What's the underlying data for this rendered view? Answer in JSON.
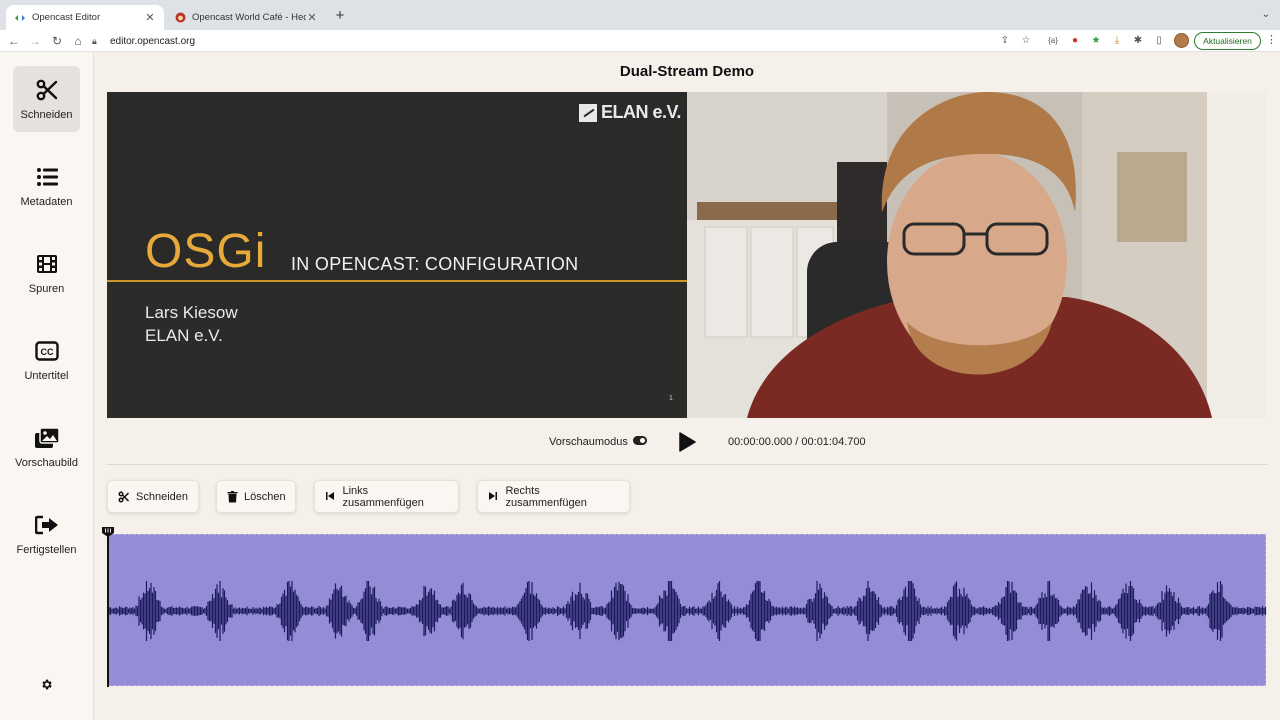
{
  "browser": {
    "tabs": [
      {
        "title": "Opencast Editor",
        "active": true
      },
      {
        "title": "Opencast World Café - Hedge…",
        "active": false
      }
    ],
    "url": "editor.opencast.org",
    "update_label": "Aktualisieren"
  },
  "sidebar": {
    "items": [
      {
        "label": "Schneiden",
        "icon": "scissors-icon",
        "active": true
      },
      {
        "label": "Metadaten",
        "icon": "list-icon",
        "active": false
      },
      {
        "label": "Spuren",
        "icon": "film-icon",
        "active": false
      },
      {
        "label": "Untertitel",
        "icon": "cc-icon",
        "active": false
      },
      {
        "label": "Vorschaubild",
        "icon": "images-icon",
        "active": false
      },
      {
        "label": "Fertigstellen",
        "icon": "sign-out-icon",
        "active": false
      }
    ],
    "settings_icon": "gear-icon"
  },
  "main": {
    "title": "Dual-Stream Demo",
    "slide": {
      "logo_text": "ELAN e.V.",
      "heading": "OSGi",
      "subheading": "IN OPENCAST: CONFIGURATION",
      "presenter_name": "Lars Kiesow",
      "presenter_org": "ELAN e.V.",
      "page_number": "1"
    },
    "controls": {
      "preview_label": "Vorschaumodus",
      "timecode": "00:00:00.000 / 00:01:04.700"
    },
    "actions": {
      "cut": "Schneiden",
      "delete": "Löschen",
      "merge_left": "Links zusammenfügen",
      "merge_right": "Rechts zusammenfügen"
    }
  },
  "colors": {
    "timeline_bg": "#958cd8",
    "waveform": "#1c1b5e",
    "accent_gold": "#e8a93b",
    "update_green": "#2e7d32"
  }
}
